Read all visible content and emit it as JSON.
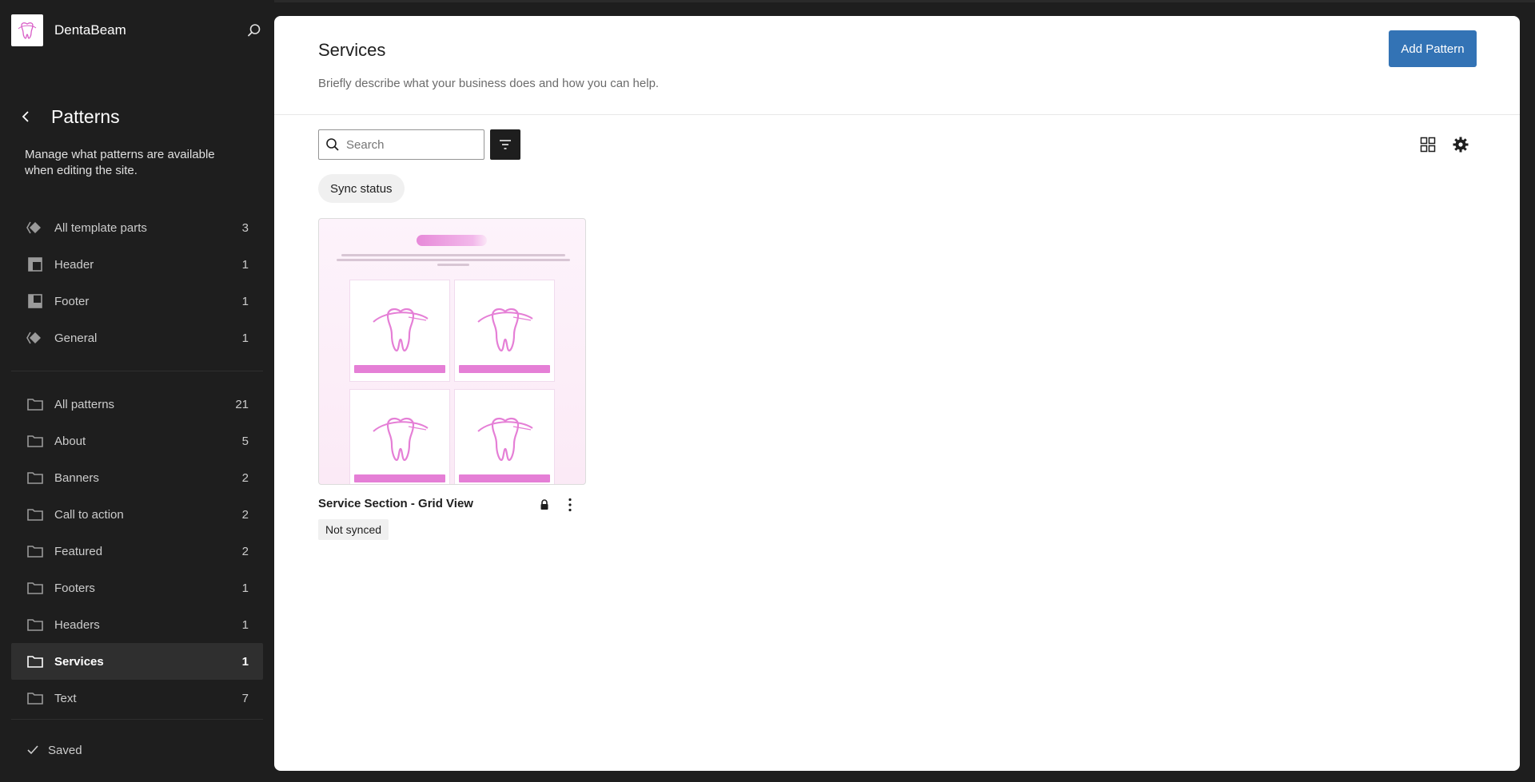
{
  "site": {
    "title": "DentaBeam"
  },
  "sidebar": {
    "title": "Patterns",
    "description": "Manage what patterns are available when editing the site.",
    "template_parts": [
      {
        "label": "All template parts",
        "count": "3",
        "icon": "template-parts-icon"
      },
      {
        "label": "Header",
        "count": "1",
        "icon": "header-icon"
      },
      {
        "label": "Footer",
        "count": "1",
        "icon": "footer-icon"
      },
      {
        "label": "General",
        "count": "1",
        "icon": "template-parts-icon"
      }
    ],
    "categories": [
      {
        "label": "All patterns",
        "count": "21"
      },
      {
        "label": "About",
        "count": "5"
      },
      {
        "label": "Banners",
        "count": "2"
      },
      {
        "label": "Call to action",
        "count": "2"
      },
      {
        "label": "Featured",
        "count": "2"
      },
      {
        "label": "Footers",
        "count": "1"
      },
      {
        "label": "Headers",
        "count": "1"
      },
      {
        "label": "Services",
        "count": "1",
        "active": true
      },
      {
        "label": "Text",
        "count": "7"
      }
    ],
    "save_status": "Saved"
  },
  "main": {
    "title": "Services",
    "description": "Briefly describe what your business does and how you can help.",
    "add_button": "Add Pattern",
    "search_placeholder": "Search",
    "sync_filter": "Sync status",
    "pattern": {
      "title": "Service Section - Grid View",
      "status": "Not synced"
    }
  },
  "colors": {
    "primary_button": "#3373b5",
    "sidebar_bg": "#1e1e1e",
    "preview_pink": "#e57fd6"
  }
}
